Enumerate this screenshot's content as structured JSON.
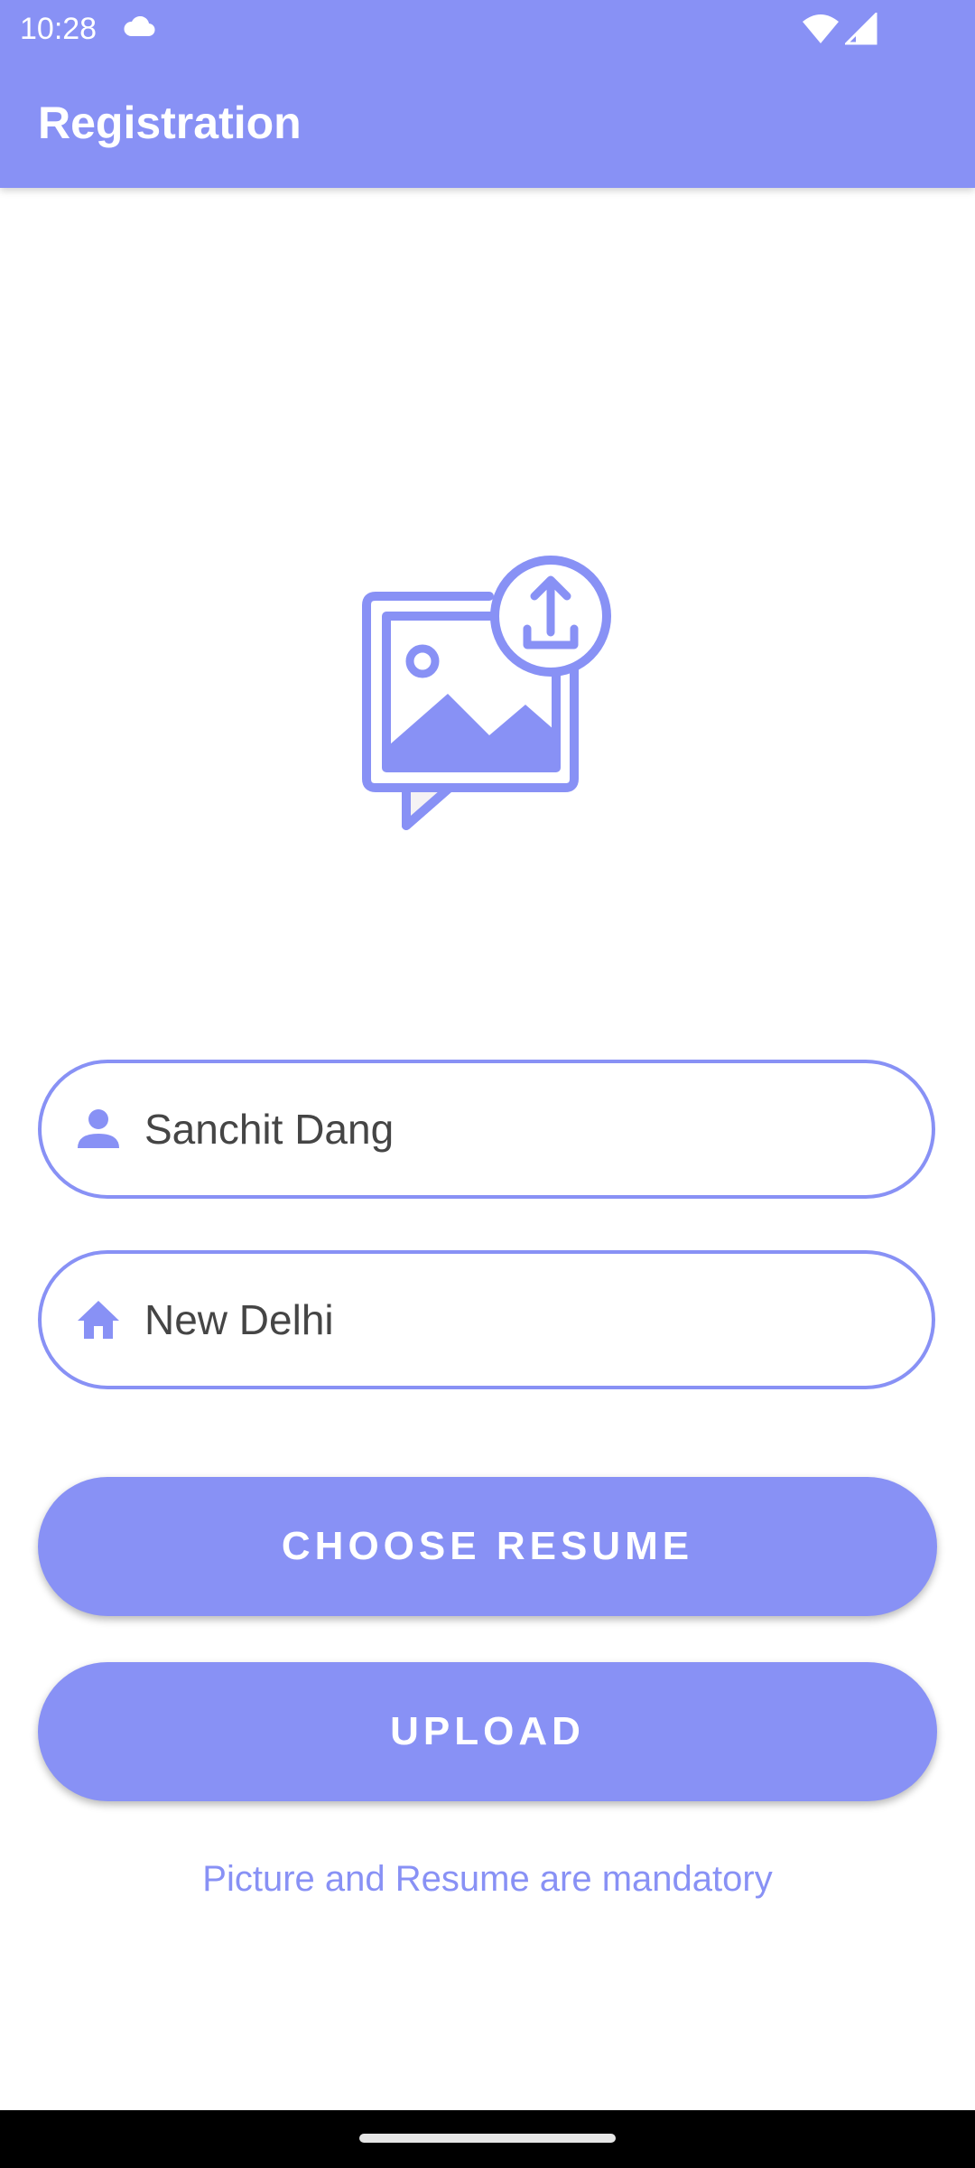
{
  "status_bar": {
    "time": "10:28",
    "icons": [
      "cloud-icon",
      "wifi-icon",
      "cellular-signal-icon"
    ]
  },
  "appbar": {
    "title": "Registration"
  },
  "hero": {
    "icon": "image-upload-icon"
  },
  "form": {
    "name_value": "Sanchit Dang",
    "name_icon": "person-icon",
    "city_value": "New Delhi",
    "city_icon": "home-icon"
  },
  "buttons": {
    "choose_resume": "CHOOSE RESUME",
    "upload": "UPLOAD"
  },
  "note": "Picture and Resume are mandatory",
  "colors": {
    "accent": "#8891F5",
    "input_text": "#454545",
    "background": "#FFFFFF",
    "nav_bar": "#000000"
  }
}
